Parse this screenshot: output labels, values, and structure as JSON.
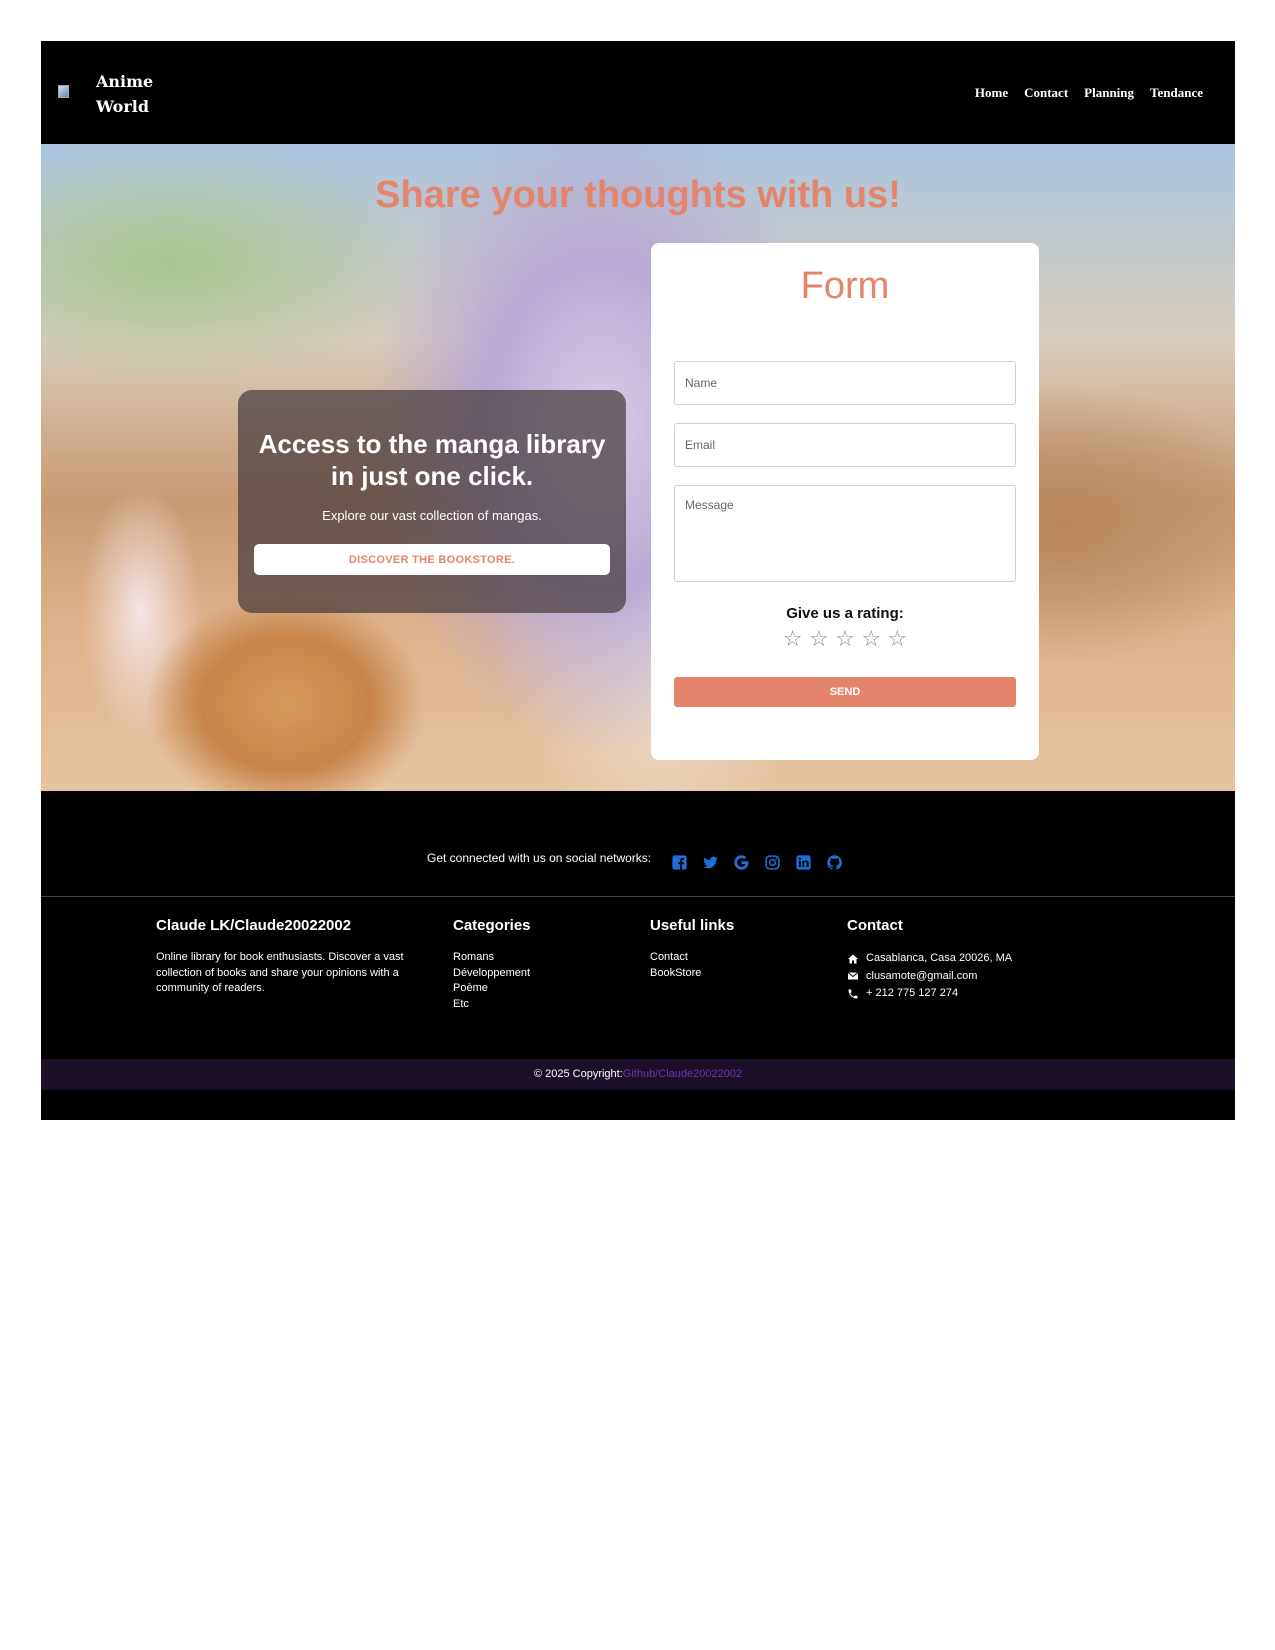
{
  "brand": {
    "line1": "Anime",
    "line2": "World"
  },
  "nav": {
    "items": [
      "Home",
      "Contact",
      "Planning",
      "Tendance"
    ]
  },
  "hero": {
    "title": "Share your thoughts with us!",
    "promo": {
      "heading": "Access to the manga library in just one click.",
      "subtitle": "Explore our vast collection of mangas.",
      "button": "DISCOVER THE BOOKSTORE."
    }
  },
  "form": {
    "title": "Form",
    "name_placeholder": "Name",
    "email_placeholder": "Email",
    "message_placeholder": "Message",
    "rating_label": "Give us a rating:",
    "stars": [
      "☆",
      "☆",
      "☆",
      "☆",
      "☆"
    ],
    "rating_value": 0,
    "rating_max": 5,
    "send": "SEND"
  },
  "footer": {
    "social_text": "Get connected with us on social networks:",
    "social_icons": [
      "facebook-icon",
      "twitter-icon",
      "google-icon",
      "instagram-icon",
      "linkedin-icon",
      "github-icon"
    ],
    "icon_color": "#1e6fd9",
    "about": {
      "title": "Claude LK/Claude20022002",
      "text": "Online library for book enthusiasts. Discover a vast collection of books and share your opinions with a community of readers."
    },
    "categories": {
      "title": "Categories",
      "items": [
        "Romans",
        "Développement",
        "Poème",
        "Etc"
      ]
    },
    "useful_links": {
      "title": "Useful links",
      "items": [
        "Contact",
        "BookStore"
      ]
    },
    "contact": {
      "title": "Contact",
      "address": "Casablanca, Casa 20026, MA",
      "email": "clusamote@gmail.com",
      "phone": "+ 212 775 127 274"
    },
    "copyright": {
      "text": "© 2025 Copyright:",
      "link": "Github/Claude20022002"
    }
  },
  "colors": {
    "accent": "#e4846a",
    "copyright_bg": "#1c1028",
    "copyright_link": "#6a35b8"
  }
}
